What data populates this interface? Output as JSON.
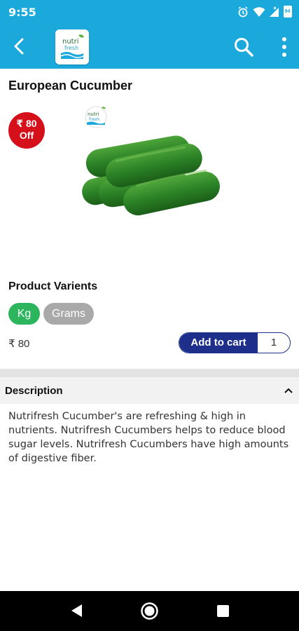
{
  "status_bar": {
    "time": "9:55",
    "battery": "94"
  },
  "app_bar": {
    "logo_alt": "Nutri fresh"
  },
  "product": {
    "title": "European Cucumber",
    "discount": {
      "line1": "₹ 80",
      "line2": "Off"
    },
    "variants_title": "Product Varients",
    "variants": [
      "Kg",
      "Grams"
    ],
    "selected_variant": "Kg",
    "price": "₹ 80",
    "add_to_cart_label": "Add to cart",
    "quantity": "1"
  },
  "description": {
    "header": "Description",
    "text": "Nutrifresh Cucumber's are refreshing & high in nutrients. Nutrifresh Cucumbers helps to reduce blood sugar levels. Nutrifresh Cucumbers have high amounts of digestive fiber."
  },
  "colors": {
    "brand": "#1ba9dc",
    "discount": "#d5101b",
    "variant_selected": "#2db55d",
    "variant_unselected": "#a9a9a9",
    "cart_button": "#1d2f8a"
  }
}
